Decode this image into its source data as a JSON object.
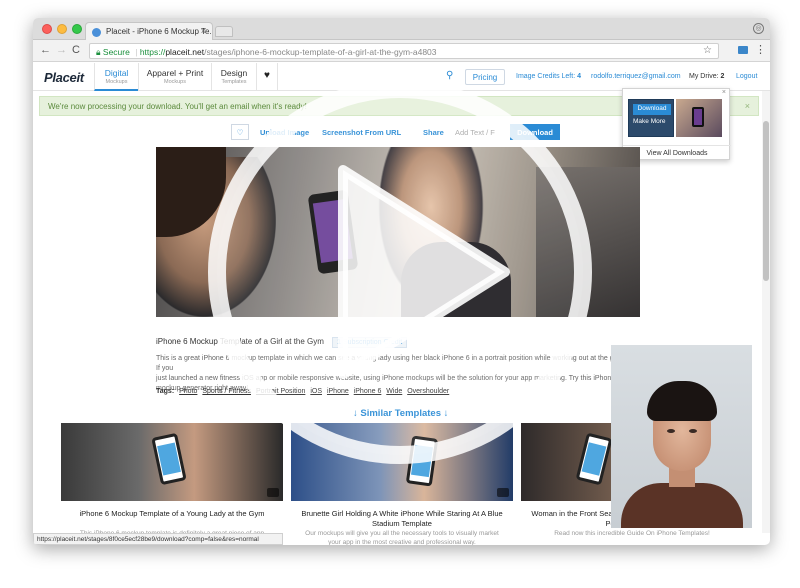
{
  "browser": {
    "tab_title": "Placeit - iPhone 6 Mockup Te...",
    "tab_close": "×",
    "secure_label": "Secure",
    "url_scheme": "https://",
    "url_host": "placeit.net",
    "url_path": "/stages/iphone-6-mockup-template-of-a-girl-at-the-gym-a4803",
    "back": "←",
    "forward": "→",
    "reload": "C",
    "star": "☆",
    "menu": "⋮",
    "profile": "◎",
    "status_url": "https://placeit.net/stages/8f0ce5ecf28be9/download?comp=false&res=normal"
  },
  "header": {
    "logo": "Placeit",
    "nav": [
      {
        "main": "Digital",
        "sub": "Mockups"
      },
      {
        "main": "Apparel + Print",
        "sub": "Mockups"
      },
      {
        "main": "Design",
        "sub": "Templates"
      }
    ],
    "heart": "♥",
    "search": "⚲",
    "pricing": "Pricing",
    "credits_label": "Image Credits Left: ",
    "credits_value": "4",
    "email": "rodolfo.terriquez@gmail.com",
    "drive_label": "My Drive: ",
    "drive_value": "2",
    "logout": "Logout"
  },
  "notice": {
    "text": "We're now processing your download. You'll get an email when it's ready!",
    "close": "×"
  },
  "downloads_popup": {
    "close": "×",
    "download": "Download",
    "make_more": "Make More",
    "view_all": "View All Downloads"
  },
  "actions": {
    "heart": "♡",
    "upload": "Upload Image",
    "screenshot": "Screenshot From URL",
    "share": "Share",
    "add_text": "Add Text / F",
    "download": "Download"
  },
  "template": {
    "title": "iPhone 6 Mockup Template of a Girl at the Gym",
    "credit": "1 Subscription Credit",
    "desc_line1": "This is a great iPhone 6 mockup template in which we can see a young lady using her black iPhone 6 in a portrait position while working out at the gym. If you",
    "desc_line2": "just launched a new fitness iOS app or mobile responsive website, using iPhone mockups will be the solution for your app marketing. Try this iPhone 6",
    "desc_line3": "mockup generator right away!",
    "tags_label": "Tags:",
    "tags": [
      "Photo",
      "Sports / Fitness",
      "Portrait Position",
      "iOS",
      "iPhone",
      "iPhone 6",
      "Wide",
      "Overshoulder"
    ],
    "similar": "↓ Similar Templates ↓"
  },
  "cards": [
    {
      "title": "iPhone 6 Mockup Template of a Young Lady at the Gym",
      "desc": "This iPhone 6 mockup template is definitely a great piece of app marketing for you to showcase your new iOS fitness app."
    },
    {
      "title": "Brunette Girl Holding A White iPhone While Staring At A Blue Stadium Template",
      "desc": "Our mockups will give you all the necessary tools to visually market your app in the most creative and professional way."
    },
    {
      "title": "Woman in the Front Seat of a Car With an iPhone Mockup in Portrait Position",
      "desc": "Read now this incredible Guide On iPhone Templates!"
    }
  ],
  "colors": {
    "accent": "#2a8bd5",
    "notice_bg": "#e6f1dc",
    "notice_text": "#5b8a3c"
  }
}
